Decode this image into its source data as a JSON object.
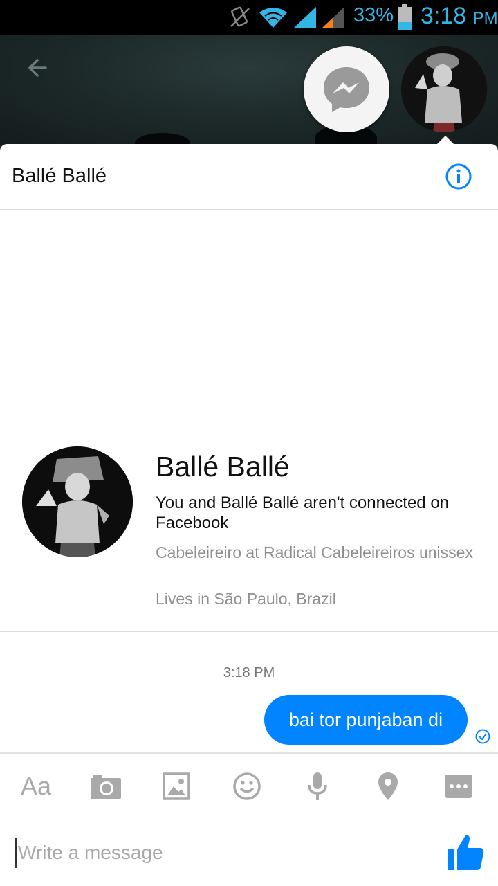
{
  "status_bar": {
    "battery_percent": "33%",
    "time": "3:18",
    "ampm": "PM",
    "icons": [
      "vibrate-icon",
      "wifi-icon",
      "signal-icon",
      "signal-2-icon",
      "battery-icon"
    ]
  },
  "header": {
    "title": "Ballé Ballé",
    "icons": [
      "back-arrow-icon",
      "messenger-icon",
      "info-icon"
    ]
  },
  "profile": {
    "name": "Ballé Ballé",
    "connection": "You and Ballé Ballé aren't connected on Facebook",
    "job": "Cabeleireiro at Radical Cabeleireiros unissex",
    "location": "Lives in São Paulo, Brazil"
  },
  "conversation": {
    "timestamp": "3:18 PM",
    "messages": [
      {
        "text": "bai tor punjaban di",
        "from": "me",
        "status": "delivered"
      }
    ]
  },
  "composer": {
    "text_label": "Aa",
    "placeholder": "Write a message",
    "tools": [
      "text-icon",
      "camera-icon",
      "gallery-icon",
      "emoji-icon",
      "mic-icon",
      "location-icon",
      "more-icon"
    ],
    "send_icon": "thumbs-up-icon"
  },
  "colors": {
    "accent": "#0084ff",
    "status_blue": "#33b5e5",
    "icon_gray": "#a9a9a9",
    "secondary_text": "#8e8e8e"
  }
}
